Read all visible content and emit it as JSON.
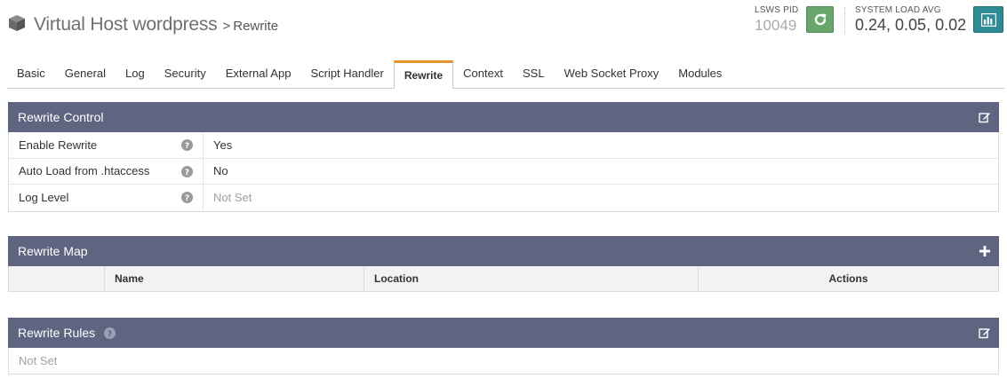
{
  "header": {
    "title": "Virtual Host wordpress",
    "separator": ">",
    "subtitle": "Rewrite",
    "pid_label": "LSWS PID",
    "pid_value": "10049",
    "load_label": "SYSTEM LOAD AVG",
    "load_value": "0.24, 0.05, 0.02"
  },
  "tabs": [
    {
      "label": "Basic"
    },
    {
      "label": "General"
    },
    {
      "label": "Log"
    },
    {
      "label": "Security"
    },
    {
      "label": "External App"
    },
    {
      "label": "Script Handler"
    },
    {
      "label": "Rewrite",
      "active": true
    },
    {
      "label": "Context"
    },
    {
      "label": "SSL"
    },
    {
      "label": "Web Socket Proxy"
    },
    {
      "label": "Modules"
    }
  ],
  "rewrite_control": {
    "title": "Rewrite Control",
    "rows": [
      {
        "label": "Enable Rewrite",
        "value": "Yes"
      },
      {
        "label": "Auto Load from .htaccess",
        "value": "No"
      },
      {
        "label": "Log Level",
        "value": "Not Set"
      }
    ]
  },
  "rewrite_map": {
    "title": "Rewrite Map",
    "columns": [
      "",
      "Name",
      "Location",
      "Actions"
    ]
  },
  "rewrite_rules": {
    "title": "Rewrite Rules",
    "value": "Not Set"
  },
  "colors": {
    "panel_header": "#5f6580",
    "active_tab_accent": "#e8922b",
    "restart_button": "#68a66b",
    "stats_button": "#2e8b96"
  },
  "icons": {
    "title": "cube-icon",
    "restart": "refresh-icon",
    "stats": "bar-chart-icon",
    "edit": "edit-icon",
    "add": "plus-icon",
    "help": "question-icon"
  }
}
